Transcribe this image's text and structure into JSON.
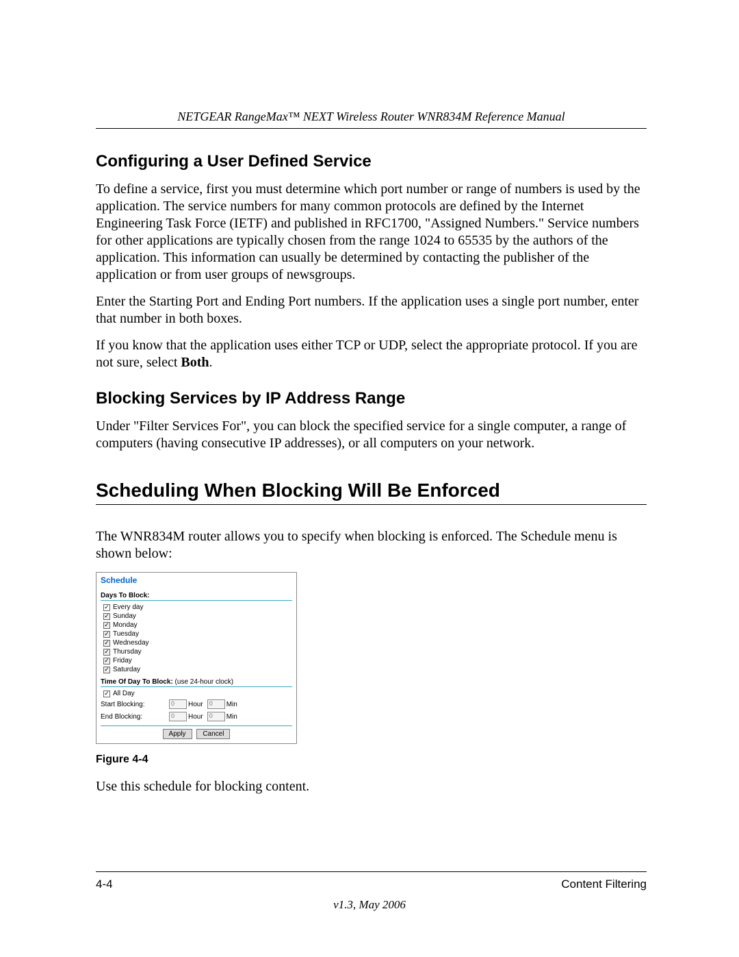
{
  "header": {
    "running_head": "NETGEAR RangeMax™ NEXT Wireless Router WNR834M Reference Manual"
  },
  "section1": {
    "title": "Configuring a User Defined Service",
    "p1": "To define a service, first you must determine which port number or range of numbers is used by the application. The service numbers for many common protocols are defined by the Internet Engineering Task Force (IETF) and published in RFC1700, \"Assigned Numbers.\" Service numbers for other applications are typically chosen from the range 1024 to 65535 by the authors of the application. This information can usually be determined by contacting the publisher of the application or from user groups of newsgroups.",
    "p2": "Enter the Starting Port and Ending Port numbers. If the application uses a single port number, enter that number in both boxes.",
    "p3_pre": "If you know that the application uses either TCP or UDP, select the appropriate protocol. If you are not sure, select ",
    "p3_bold": "Both",
    "p3_post": "."
  },
  "section2": {
    "title": "Blocking Services by IP Address Range",
    "p1": "Under \"Filter Services For\", you can block the specified service for a single computer, a range of computers (having consecutive IP addresses), or all computers on your network."
  },
  "chapter": {
    "title": "Scheduling When Blocking Will Be Enforced",
    "p1": "The WNR834M router allows you to specify when blocking is enforced. The Schedule menu is shown below:"
  },
  "schedule": {
    "title": "Schedule",
    "days_heading": "Days To Block:",
    "days": [
      "Every day",
      "Sunday",
      "Monday",
      "Tuesday",
      "Wednesday",
      "Thursday",
      "Friday",
      "Saturday"
    ],
    "time_heading": "Time Of Day To Block:",
    "time_hint": "(use 24-hour clock)",
    "all_day": "All Day",
    "start_label": "Start Blocking:",
    "end_label": "End Blocking:",
    "hour": "Hour",
    "min": "Min",
    "val": "0",
    "apply": "Apply",
    "cancel": "Cancel"
  },
  "figure_caption": "Figure 4-4",
  "after_figure": "Use this schedule for blocking content.",
  "footer": {
    "page": "4-4",
    "section": "Content Filtering",
    "version": "v1.3, May 2006"
  }
}
